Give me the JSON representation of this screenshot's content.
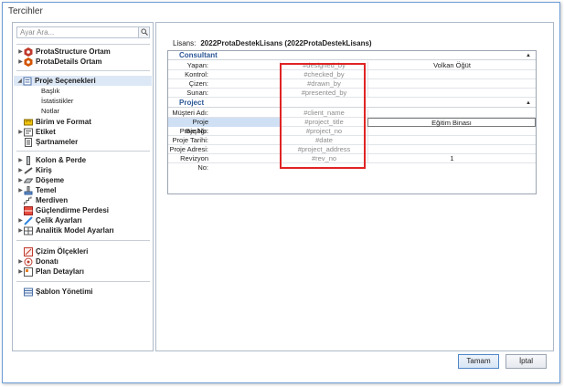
{
  "window": {
    "title": "Tercihler"
  },
  "search": {
    "placeholder": "Ayar Ara..."
  },
  "tree": [
    {
      "label": "ProtaStructure Ortam",
      "bold": true,
      "arrow": true,
      "icon": "protastructure-icon"
    },
    {
      "label": "ProtaDetails Ortam",
      "bold": true,
      "arrow": true,
      "icon": "protadetails-icon"
    },
    {
      "label": "Proje Seçenekleri",
      "bold": true,
      "arrow": true,
      "icon": "project-options-icon",
      "selected": true
    },
    {
      "label": "Başlık",
      "sub": true
    },
    {
      "label": "İstatistikler",
      "sub": true
    },
    {
      "label": "Notlar",
      "sub": true
    },
    {
      "label": "Birim ve Format",
      "bold": true,
      "icon": "units-icon"
    },
    {
      "label": "Etiket",
      "bold": true,
      "arrow": true,
      "icon": "label-icon"
    },
    {
      "label": "Şartnameler",
      "bold": true,
      "icon": "codes-icon"
    },
    {
      "label": "Kolon & Perde",
      "bold": true,
      "arrow": true,
      "icon": "column-icon"
    },
    {
      "label": "Kiriş",
      "bold": true,
      "arrow": true,
      "icon": "beam-icon"
    },
    {
      "label": "Döşeme",
      "bold": true,
      "arrow": true,
      "icon": "slab-icon"
    },
    {
      "label": "Temel",
      "bold": true,
      "arrow": true,
      "icon": "foundation-icon"
    },
    {
      "label": "Merdiven",
      "bold": true,
      "icon": "stair-icon"
    },
    {
      "label": "Güçlendirme Perdesi",
      "bold": true,
      "icon": "strengthening-wall-icon"
    },
    {
      "label": "Çelik Ayarları",
      "bold": true,
      "arrow": true,
      "icon": "steel-icon"
    },
    {
      "label": "Analitik Model Ayarları",
      "bold": true,
      "arrow": true,
      "icon": "analytical-model-icon"
    },
    {
      "label": "Çizim Ölçekleri",
      "bold": true,
      "icon": "drawing-scales-icon"
    },
    {
      "label": "Donatı",
      "bold": true,
      "arrow": true,
      "icon": "rebar-icon"
    },
    {
      "label": "Plan Detayları",
      "bold": true,
      "arrow": true,
      "icon": "plan-details-icon"
    },
    {
      "label": "Şablon Yönetimi",
      "bold": true,
      "icon": "template-icon"
    }
  ],
  "license": {
    "label": "Lisans:",
    "value": "2022ProtaDestekLisans (2022ProtaDestekLisans)"
  },
  "groups": [
    {
      "name": "Consultant",
      "rows": [
        {
          "key": "Yapan:",
          "tag": "#designed_by",
          "value": "Volkan Öğüt"
        },
        {
          "key": "Kontrol:",
          "tag": "#checked_by",
          "value": ""
        },
        {
          "key": "Çizen:",
          "tag": "#drawn_by",
          "value": ""
        },
        {
          "key": "Sunan:",
          "tag": "#presented_by",
          "value": ""
        }
      ]
    },
    {
      "name": "Project",
      "rows": [
        {
          "key": "Müşteri Adı:",
          "tag": "#client_name",
          "value": ""
        },
        {
          "key": "Proje Başlığı:",
          "tag": "#project_title",
          "value": "Eğitim Binası",
          "selected": true
        },
        {
          "key": "Proje No:",
          "tag": "#project_no",
          "value": ""
        },
        {
          "key": "Proje Tarihi:",
          "tag": "#date",
          "value": ""
        },
        {
          "key": "Proje Adresi:",
          "tag": "#project_address",
          "value": ""
        },
        {
          "key": "Revizyon No:",
          "tag": "#rev_no",
          "value": "1"
        }
      ]
    }
  ],
  "buttons": {
    "ok": "Tamam",
    "cancel": "İptal"
  },
  "colors": {
    "accent": "#2b5797",
    "highlight": "#e02424",
    "selection": "#cfe0f4"
  }
}
